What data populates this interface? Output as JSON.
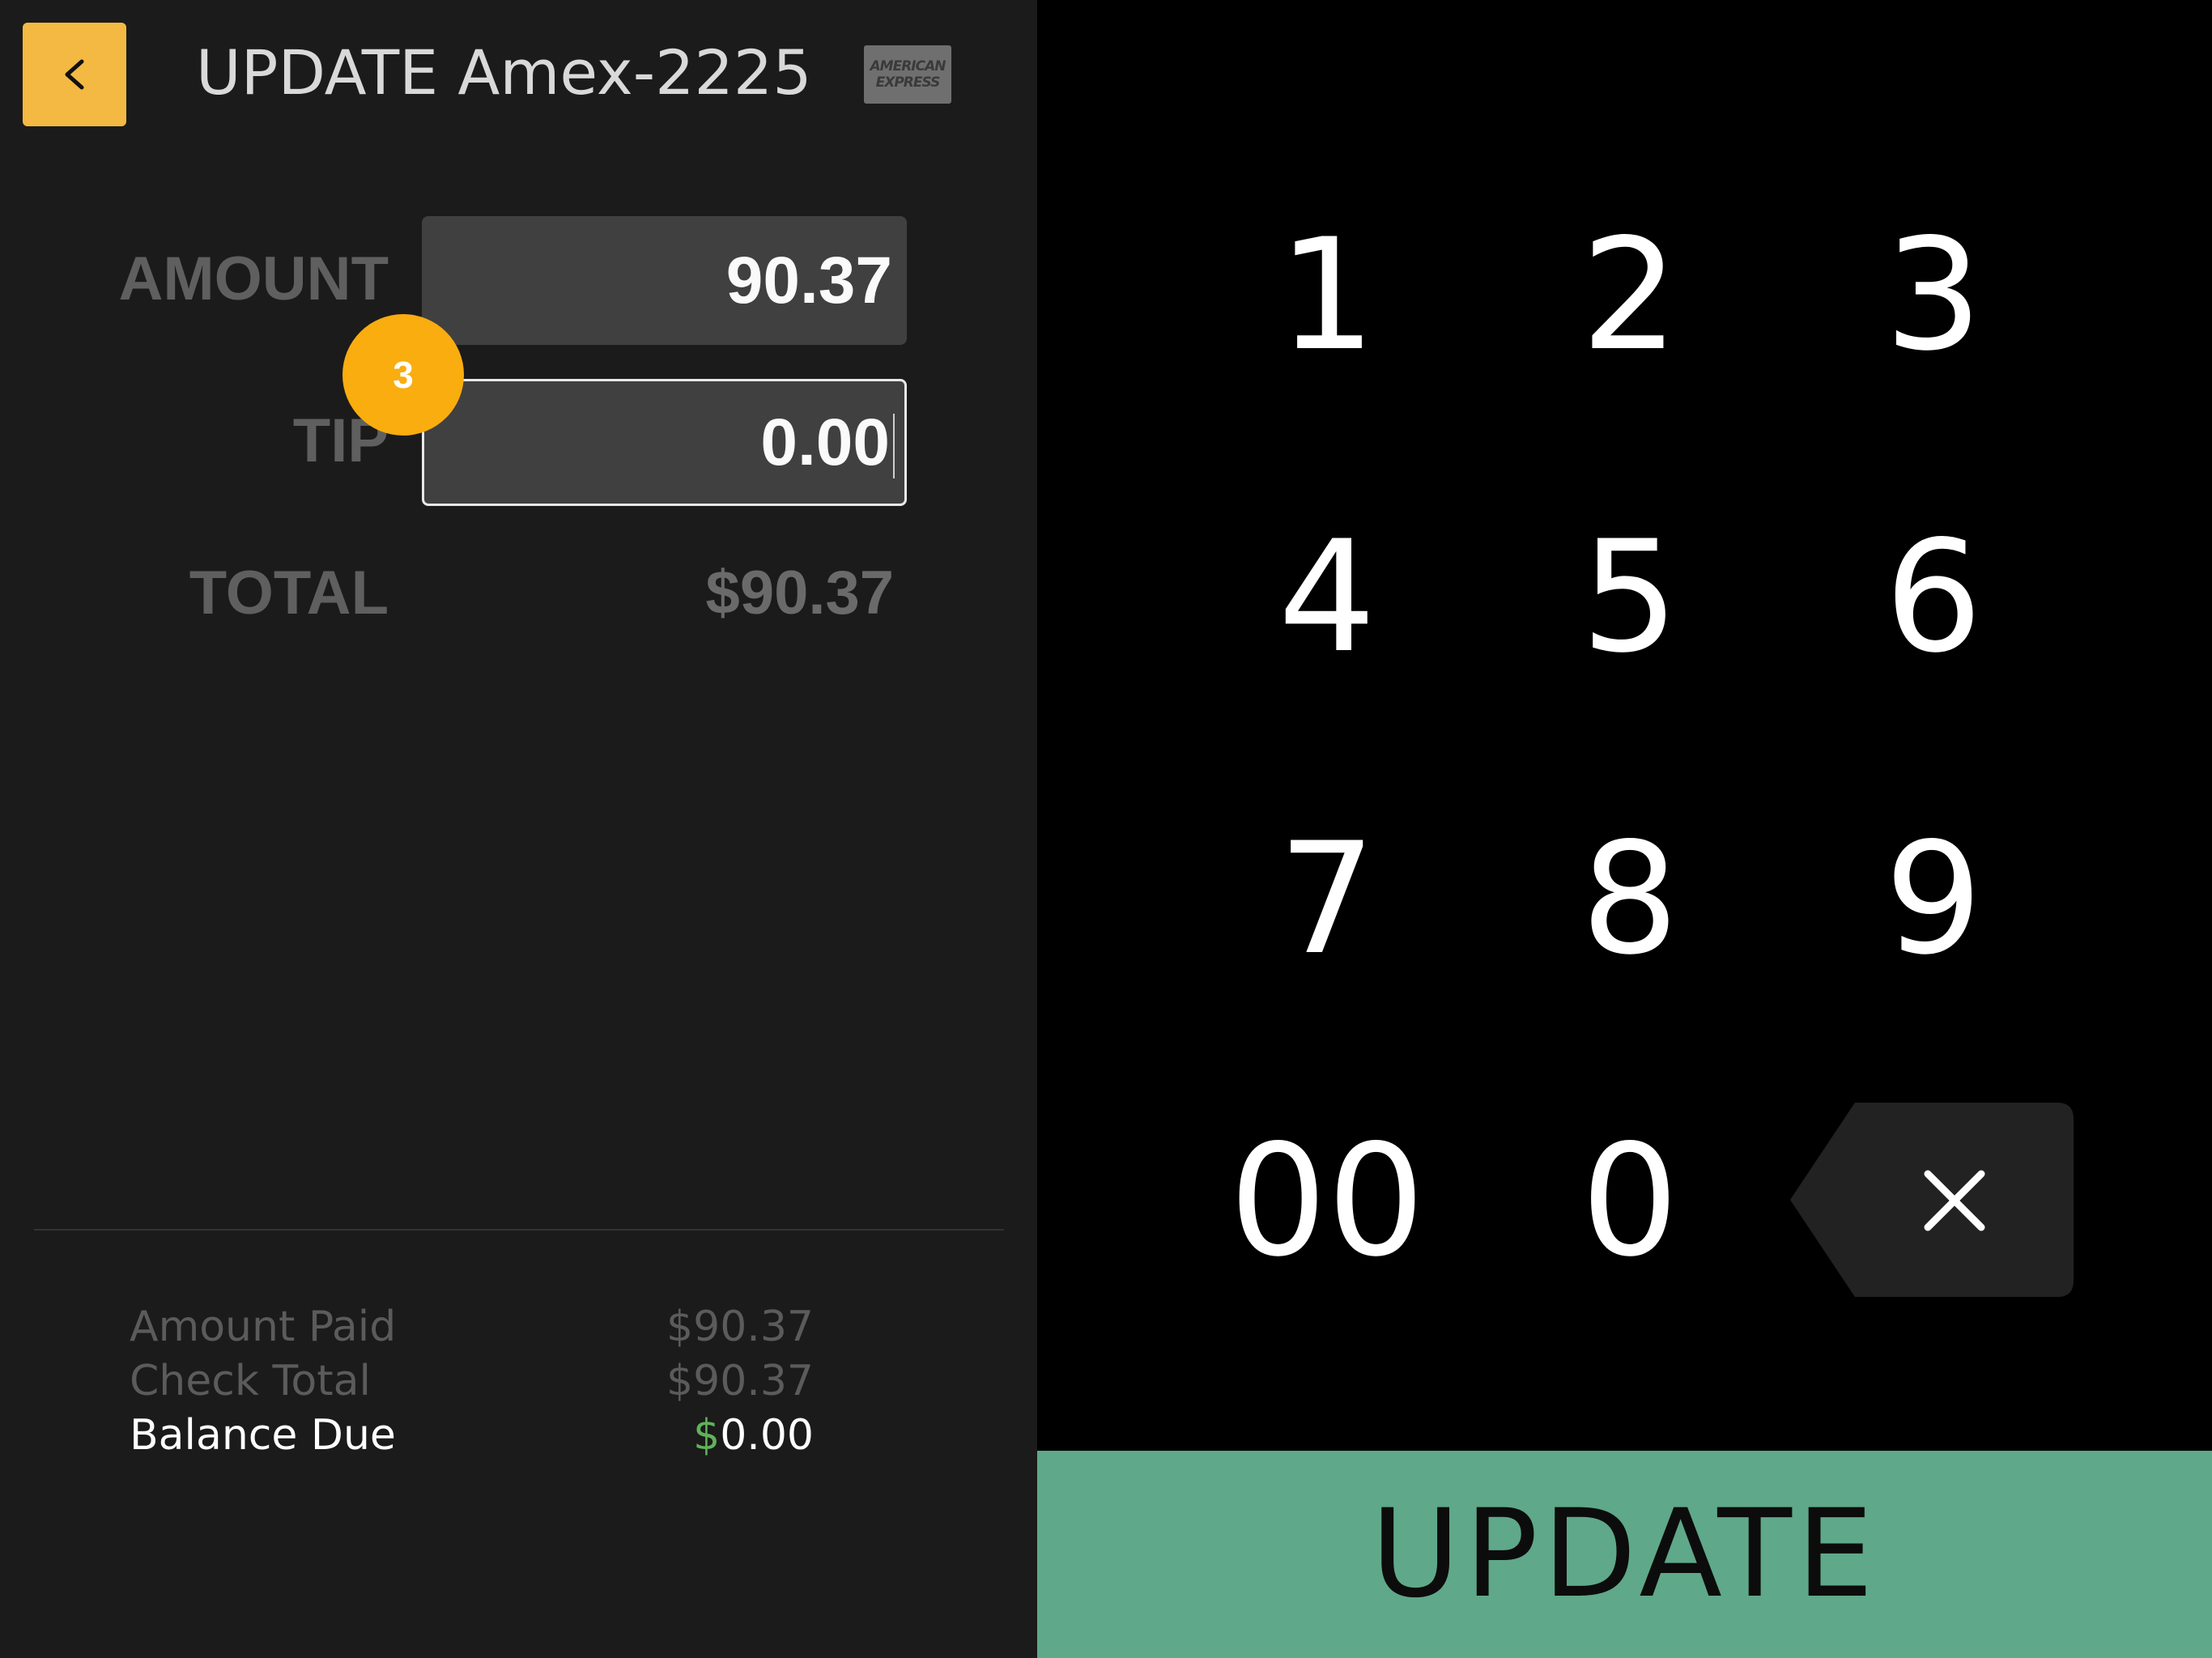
{
  "header": {
    "back_label": "back",
    "title": "UPDATE Amex-2225",
    "card_logo_line1": "AMERICAN",
    "card_logo_line2": "EXPRESS",
    "card_logo_icon": "amex-card-icon"
  },
  "form": {
    "amount_label": "AMOUNT",
    "amount_value": "90.37",
    "tip_label": "TIP",
    "tip_value": "0.00",
    "total_label": "TOTAL",
    "total_value": "$90.37"
  },
  "step_badge": "3",
  "summary": {
    "amount_paid_label": "Amount Paid",
    "amount_paid_value": "$90.37",
    "check_total_label": "Check Total",
    "check_total_value": "$90.37",
    "balance_due_label": "Balance Due",
    "balance_due_currency": "$",
    "balance_due_amount": "0.00"
  },
  "keypad": {
    "keys": [
      "1",
      "2",
      "3",
      "4",
      "5",
      "6",
      "7",
      "8",
      "9",
      "00",
      "0"
    ],
    "backspace_icon": "backspace-icon"
  },
  "update_label": "UPDATE",
  "colors": {
    "accent_yellow": "#f4b942",
    "badge_orange": "#f9ad0f",
    "update_green": "#5fa88a",
    "balance_dollar_green": "#5fb35a"
  }
}
